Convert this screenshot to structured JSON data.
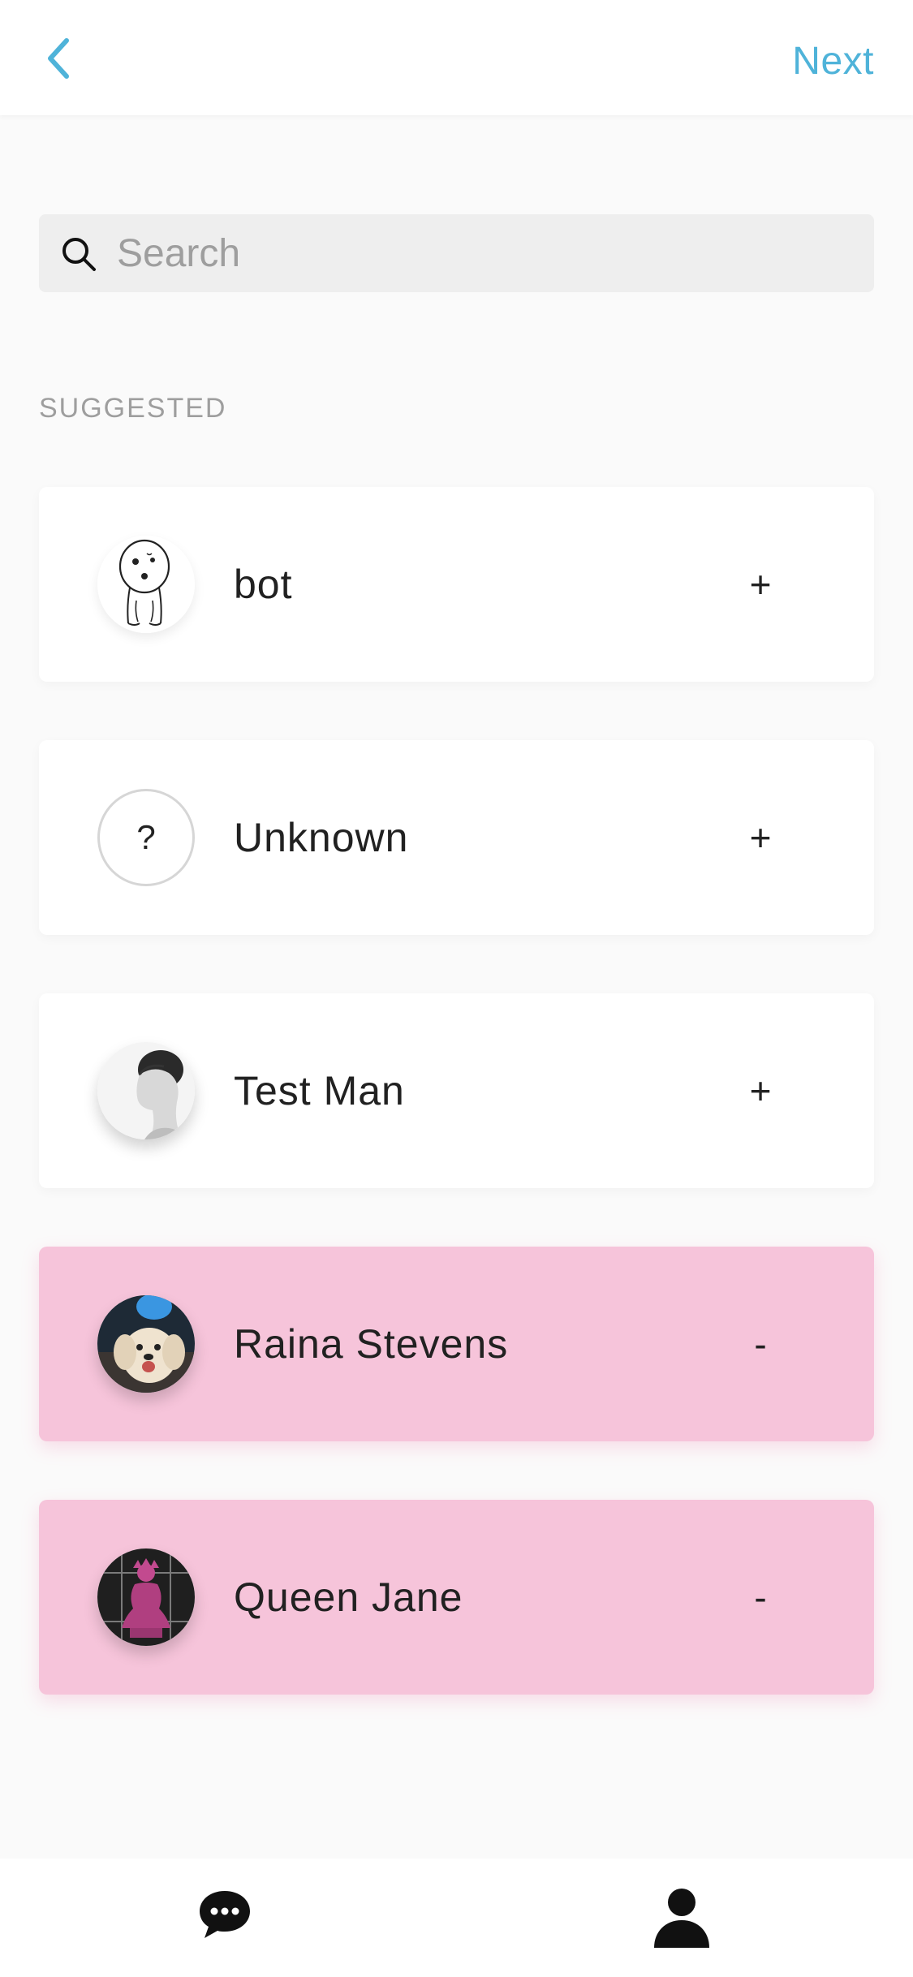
{
  "header": {
    "back_icon": "chevron-left-icon",
    "next_label": "Next",
    "accent_color": "#4fb3d9"
  },
  "search": {
    "placeholder": "Search",
    "value": "",
    "icon": "search-icon"
  },
  "suggested": {
    "section_label": "SUGGESTED",
    "contacts": [
      {
        "name": "bot",
        "action": "+",
        "selected": false,
        "avatar": "bot-sketch"
      },
      {
        "name": "Unknown",
        "action": "+",
        "selected": false,
        "avatar": "?"
      },
      {
        "name": "Test Man",
        "action": "+",
        "selected": false,
        "avatar": "portrait-photo"
      },
      {
        "name": "Raina Stevens",
        "action": "-",
        "selected": true,
        "avatar": "puppy-photo"
      },
      {
        "name": "Queen Jane",
        "action": "-",
        "selected": true,
        "avatar": "pink-bust-photo"
      }
    ],
    "selected_color": "#f6c4da"
  },
  "bottom_nav": {
    "items": [
      {
        "icon": "chat-bubble-icon"
      },
      {
        "icon": "person-icon"
      }
    ]
  }
}
